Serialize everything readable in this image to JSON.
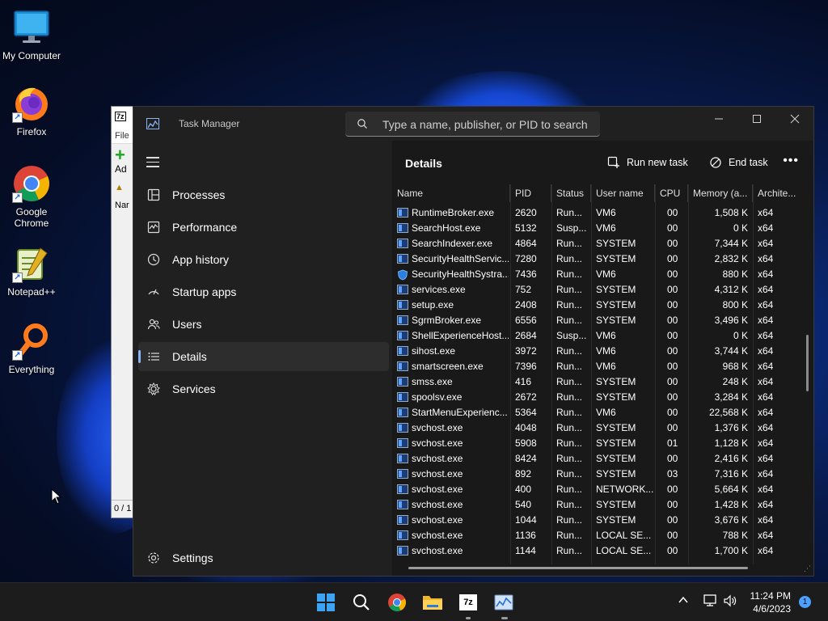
{
  "desktop": {
    "icons": [
      {
        "label": "My Computer",
        "icon": "monitor-icon"
      },
      {
        "label": "Firefox",
        "icon": "firefox-icon"
      },
      {
        "label": "Google Chrome",
        "icon": "chrome-icon"
      },
      {
        "label": "Notepad++",
        "icon": "notepad-plus-plus-icon"
      },
      {
        "label": "Everything",
        "icon": "magnifier-icon"
      }
    ]
  },
  "zip_window": {
    "badge": "7z",
    "menu": "File",
    "toolbar_label": "Ad",
    "column": "Nar",
    "status": "0 / 1"
  },
  "task_manager": {
    "title": "Task Manager",
    "search_placeholder": "Type a name, publisher, or PID to search",
    "nav": [
      {
        "label": "Processes",
        "icon": "processes-icon"
      },
      {
        "label": "Performance",
        "icon": "performance-icon"
      },
      {
        "label": "App history",
        "icon": "history-icon"
      },
      {
        "label": "Startup apps",
        "icon": "startup-icon"
      },
      {
        "label": "Users",
        "icon": "users-icon"
      },
      {
        "label": "Details",
        "icon": "details-icon",
        "active": true
      },
      {
        "label": "Services",
        "icon": "services-icon"
      }
    ],
    "settings_label": "Settings",
    "page_title": "Details",
    "run_new_task": "Run new task",
    "end_task": "End task",
    "columns": [
      "Name",
      "PID",
      "Status",
      "User name",
      "CPU",
      "Memory (a...",
      "Archite..."
    ],
    "rows": [
      {
        "name": "RuntimeBroker.exe",
        "pid": "2620",
        "status": "Run...",
        "user": "VM6",
        "cpu": "00",
        "mem": "1,508 K",
        "arch": "x64",
        "icon": "app"
      },
      {
        "name": "SearchHost.exe",
        "pid": "5132",
        "status": "Susp...",
        "user": "VM6",
        "cpu": "00",
        "mem": "0 K",
        "arch": "x64",
        "icon": "app"
      },
      {
        "name": "SearchIndexer.exe",
        "pid": "4864",
        "status": "Run...",
        "user": "SYSTEM",
        "cpu": "00",
        "mem": "7,344 K",
        "arch": "x64",
        "icon": "indexer"
      },
      {
        "name": "SecurityHealthServic...",
        "pid": "7280",
        "status": "Run...",
        "user": "SYSTEM",
        "cpu": "00",
        "mem": "2,832 K",
        "arch": "x64",
        "icon": "app"
      },
      {
        "name": "SecurityHealthSystra...",
        "pid": "7436",
        "status": "Run...",
        "user": "VM6",
        "cpu": "00",
        "mem": "880 K",
        "arch": "x64",
        "icon": "shield"
      },
      {
        "name": "services.exe",
        "pid": "752",
        "status": "Run...",
        "user": "SYSTEM",
        "cpu": "00",
        "mem": "4,312 K",
        "arch": "x64",
        "icon": "app"
      },
      {
        "name": "setup.exe",
        "pid": "2408",
        "status": "Run...",
        "user": "SYSTEM",
        "cpu": "00",
        "mem": "800 K",
        "arch": "x64",
        "icon": "setup"
      },
      {
        "name": "SgrmBroker.exe",
        "pid": "6556",
        "status": "Run...",
        "user": "SYSTEM",
        "cpu": "00",
        "mem": "3,496 K",
        "arch": "x64",
        "icon": "app"
      },
      {
        "name": "ShellExperienceHost....",
        "pid": "2684",
        "status": "Susp...",
        "user": "VM6",
        "cpu": "00",
        "mem": "0 K",
        "arch": "x64",
        "icon": "app"
      },
      {
        "name": "sihost.exe",
        "pid": "3972",
        "status": "Run...",
        "user": "VM6",
        "cpu": "00",
        "mem": "3,744 K",
        "arch": "x64",
        "icon": "app"
      },
      {
        "name": "smartscreen.exe",
        "pid": "7396",
        "status": "Run...",
        "user": "VM6",
        "cpu": "00",
        "mem": "968 K",
        "arch": "x64",
        "icon": "app"
      },
      {
        "name": "smss.exe",
        "pid": "416",
        "status": "Run...",
        "user": "SYSTEM",
        "cpu": "00",
        "mem": "248 K",
        "arch": "x64",
        "icon": "app"
      },
      {
        "name": "spoolsv.exe",
        "pid": "2672",
        "status": "Run...",
        "user": "SYSTEM",
        "cpu": "00",
        "mem": "3,284 K",
        "arch": "x64",
        "icon": "printer"
      },
      {
        "name": "StartMenuExperienc...",
        "pid": "5364",
        "status": "Run...",
        "user": "VM6",
        "cpu": "00",
        "mem": "22,568 K",
        "arch": "x64",
        "icon": "app"
      },
      {
        "name": "svchost.exe",
        "pid": "4048",
        "status": "Run...",
        "user": "SYSTEM",
        "cpu": "00",
        "mem": "1,376 K",
        "arch": "x64",
        "icon": "app"
      },
      {
        "name": "svchost.exe",
        "pid": "5908",
        "status": "Run...",
        "user": "SYSTEM",
        "cpu": "01",
        "mem": "1,128 K",
        "arch": "x64",
        "icon": "app"
      },
      {
        "name": "svchost.exe",
        "pid": "8424",
        "status": "Run...",
        "user": "SYSTEM",
        "cpu": "00",
        "mem": "2,416 K",
        "arch": "x64",
        "icon": "app"
      },
      {
        "name": "svchost.exe",
        "pid": "892",
        "status": "Run...",
        "user": "SYSTEM",
        "cpu": "03",
        "mem": "7,316 K",
        "arch": "x64",
        "icon": "app"
      },
      {
        "name": "svchost.exe",
        "pid": "400",
        "status": "Run...",
        "user": "NETWORK...",
        "cpu": "00",
        "mem": "5,664 K",
        "arch": "x64",
        "icon": "app"
      },
      {
        "name": "svchost.exe",
        "pid": "540",
        "status": "Run...",
        "user": "SYSTEM",
        "cpu": "00",
        "mem": "1,428 K",
        "arch": "x64",
        "icon": "app"
      },
      {
        "name": "svchost.exe",
        "pid": "1044",
        "status": "Run...",
        "user": "SYSTEM",
        "cpu": "00",
        "mem": "3,676 K",
        "arch": "x64",
        "icon": "app"
      },
      {
        "name": "svchost.exe",
        "pid": "1136",
        "status": "Run...",
        "user": "LOCAL SE...",
        "cpu": "00",
        "mem": "788 K",
        "arch": "x64",
        "icon": "app"
      },
      {
        "name": "svchost.exe",
        "pid": "1144",
        "status": "Run...",
        "user": "LOCAL SE...",
        "cpu": "00",
        "mem": "1,700 K",
        "arch": "x64",
        "icon": "app"
      }
    ]
  },
  "taskbar": {
    "apps": [
      "start-icon",
      "search-icon",
      "chrome-icon",
      "file-explorer-icon",
      "7zip-icon",
      "task-manager-icon"
    ],
    "time": "11:24 PM",
    "date": "4/6/2023",
    "notification_count": "1"
  },
  "colors": {
    "accent": "#8ab4f8",
    "window_bg": "#202020",
    "list_bg": "#191919",
    "taskbar_bg": "#1c1c1c"
  }
}
